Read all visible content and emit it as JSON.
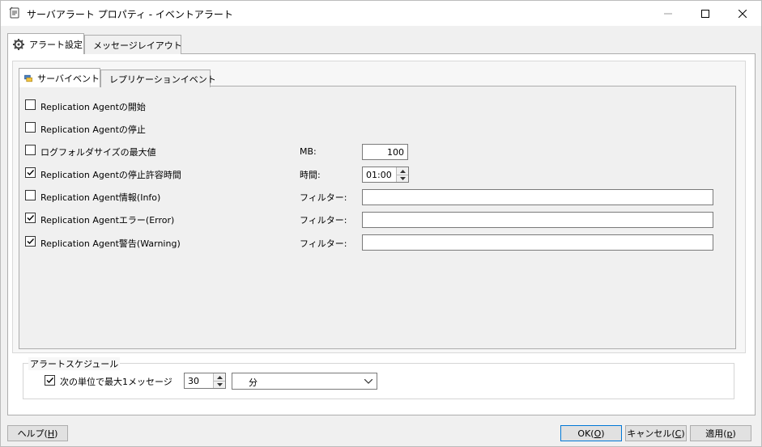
{
  "window": {
    "title": "サーバアラート プロパティ - イベントアラート"
  },
  "outer_tabs": [
    {
      "label": "アラート設定",
      "icon": "gear-icon",
      "active": true
    },
    {
      "label": "メッセージレイアウト",
      "icon": "document-icon",
      "active": false
    }
  ],
  "inner_tabs": [
    {
      "label": "サーバイベント",
      "icon": "server-icon",
      "active": true
    },
    {
      "label": "レプリケーションイベント",
      "icon": "replication-icon",
      "active": false
    }
  ],
  "events": [
    {
      "label": "Replication Agentの開始",
      "checked": false
    },
    {
      "label": "Replication Agentの停止",
      "checked": false
    },
    {
      "label": "ログフォルダサイズの最大値",
      "checked": false,
      "param_label": "MB:",
      "value": "100"
    },
    {
      "label": "Replication Agentの停止許容時間",
      "checked": true,
      "param_label": "時間:",
      "value": "01:00"
    },
    {
      "label": "Replication Agent情報(Info)",
      "checked": false,
      "param_label": "フィルター:",
      "value": ""
    },
    {
      "label": "Replication Agentエラー(Error)",
      "checked": true,
      "param_label": "フィルター:",
      "value": ""
    },
    {
      "label": "Replication Agent警告(Warning)",
      "checked": true,
      "param_label": "フィルター:",
      "value": ""
    }
  ],
  "schedule": {
    "group_title": "アラートスケジュール",
    "checkbox_label": "次の単位で最大1メッセージ",
    "checked": true,
    "value": "30",
    "unit": "分"
  },
  "buttons": {
    "help": {
      "label": "ヘルプ(",
      "accel": "H",
      "tail": ")"
    },
    "ok": {
      "label": "OK(",
      "accel": "O",
      "tail": ")"
    },
    "cancel": {
      "label": "キャンセル(",
      "accel": "C",
      "tail": ")"
    },
    "apply": {
      "label": "適用(",
      "accel": "p",
      "tail": ")"
    }
  }
}
